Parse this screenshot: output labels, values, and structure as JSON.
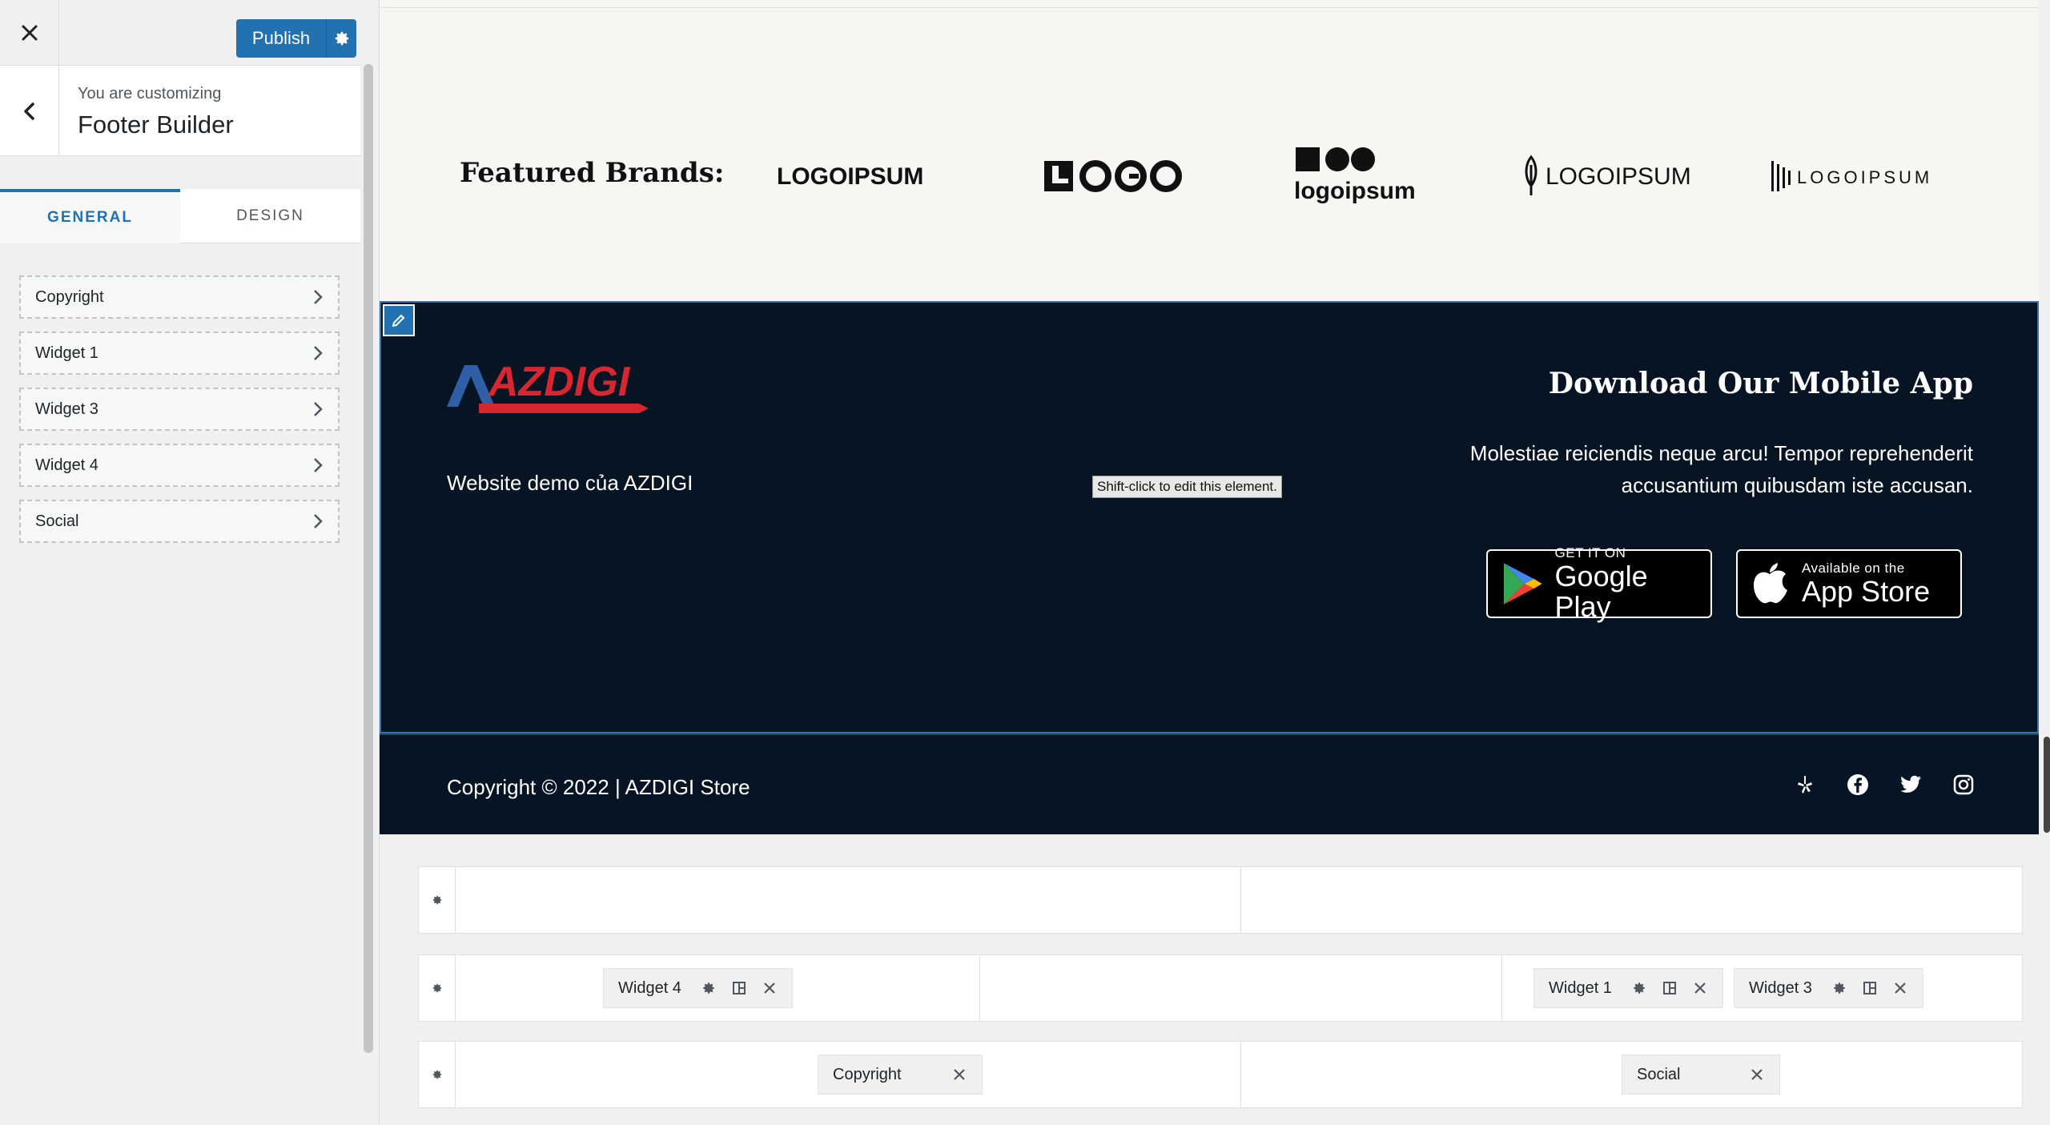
{
  "sidebar": {
    "publish_label": "Publish",
    "customizing_label": "You are customizing",
    "section_title": "Footer Builder",
    "tabs": [
      {
        "label": "GENERAL"
      },
      {
        "label": "DESIGN"
      }
    ],
    "items": [
      {
        "label": "Copyright"
      },
      {
        "label": "Widget 1"
      },
      {
        "label": "Widget 3"
      },
      {
        "label": "Widget 4"
      },
      {
        "label": "Social"
      }
    ]
  },
  "preview": {
    "brands_title": "Featured Brands:",
    "brands": [
      {
        "text": "LOGOIPSUM"
      },
      {
        "text": "LOGO"
      },
      {
        "text": "logoipsum"
      },
      {
        "text": "LOGOIPSUM"
      },
      {
        "text": "LOGOIPSUM"
      }
    ],
    "footer": {
      "logo_text": "AZDIGI",
      "site_description": "Website demo của AZDIGI",
      "tooltip": "Shift-click to edit this element.",
      "app_title": "Download Our Mobile App",
      "app_description": "Molestiae reiciendis neque arcu! Tempor reprehenderit accusantium quibusdam iste accusan.",
      "google_small": "GET IT ON",
      "google_big": "Google Play",
      "apple_small": "Available on the",
      "apple_big": "App Store",
      "copyright": "Copyright © 2022 | AZDIGI Store"
    }
  },
  "builder": {
    "row2": {
      "chips": [
        {
          "label": "Widget 4"
        },
        {
          "label": "Widget 1"
        },
        {
          "label": "Widget 3"
        }
      ]
    },
    "row3": {
      "chips": [
        {
          "label": "Copyright"
        },
        {
          "label": "Social"
        }
      ]
    }
  },
  "colors": {
    "accent": "#2271b1",
    "footer_bg": "#061424",
    "brand_red": "#d8262f",
    "brand_blue": "#2f5fa7"
  }
}
